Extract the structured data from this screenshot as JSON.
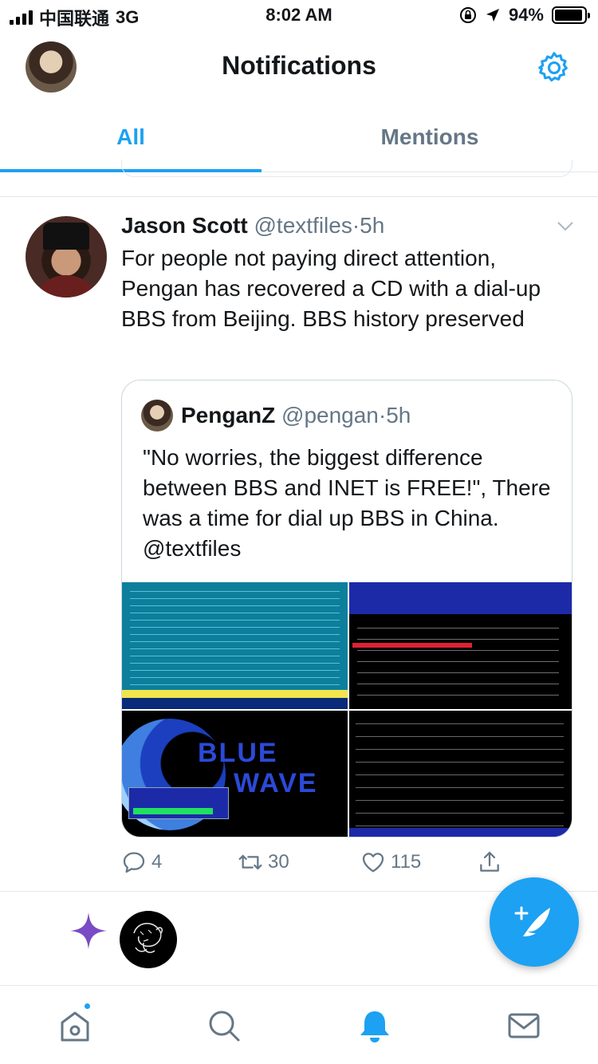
{
  "status_bar": {
    "carrier": "中国联通",
    "network": "3G",
    "time": "8:02 AM",
    "battery_percent": "94%",
    "battery_level": 0.94
  },
  "header": {
    "title": "Notifications"
  },
  "tabs": [
    {
      "label": "All",
      "active": true
    },
    {
      "label": "Mentions",
      "active": false
    }
  ],
  "tweet": {
    "name": "Jason Scott",
    "handle": "@textfiles",
    "separator": "·",
    "time": "5h",
    "text": "For people not paying direct attention, Pengan has recovered a CD with a dial-up BBS from Beijing. BBS history preserved",
    "quote": {
      "name": "PenganZ",
      "handle": "@pengan",
      "separator": "·",
      "time": "5h",
      "text": "\"No worries, the biggest difference between BBS and INET is FREE!\", There was a time for dial up BBS in China. @textfiles"
    },
    "actions": {
      "replies": "4",
      "retweets": "30",
      "likes": "115"
    }
  },
  "colors": {
    "accent": "#1da1f2",
    "text": "#14171a",
    "secondary": "#657786",
    "border": "#e1e8ed",
    "sparkle": "#794bc4"
  },
  "icons": {
    "settings": "gear-icon",
    "caret": "chevron-down-icon",
    "reply": "reply-icon",
    "retweet": "retweet-icon",
    "like": "heart-icon",
    "share": "share-icon",
    "compose": "compose-tweet-icon",
    "home": "home-icon",
    "search": "search-icon",
    "notifications": "bell-icon",
    "messages": "mail-icon"
  }
}
